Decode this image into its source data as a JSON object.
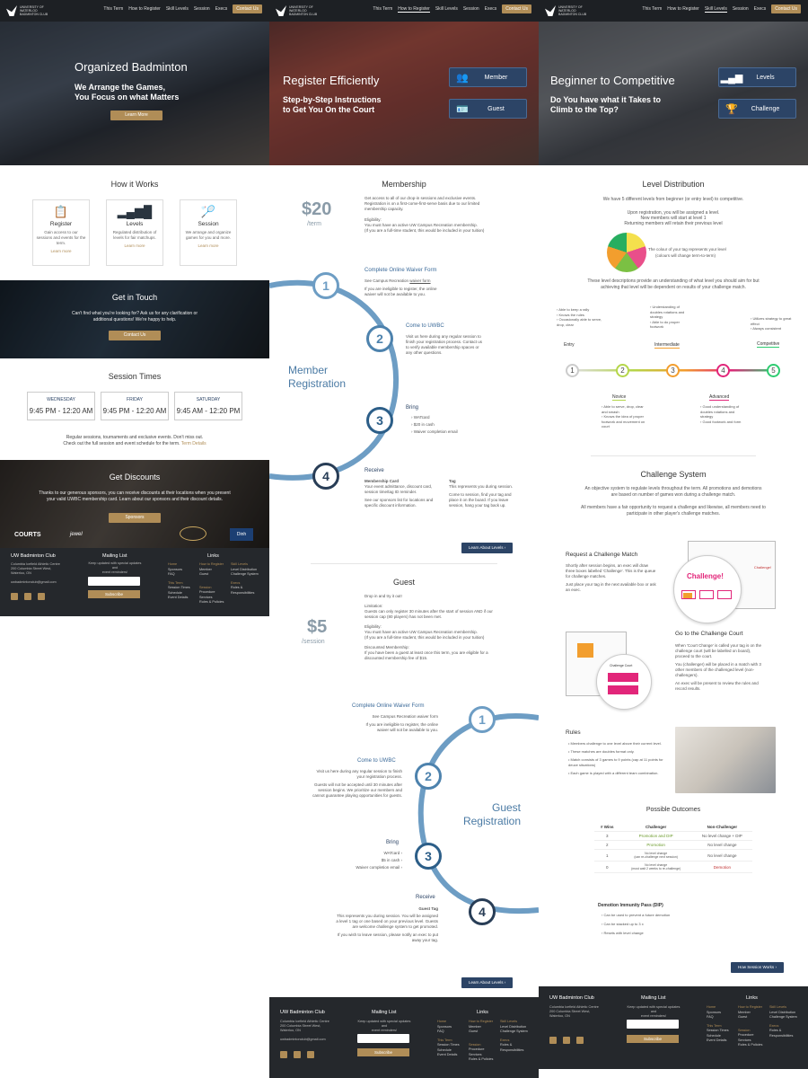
{
  "nav": {
    "logo": "UNIVERSITY OF WATERLOO BADMINTON CLUB",
    "items": [
      "This Term",
      "How to Register",
      "Skill Levels",
      "Session",
      "Execs"
    ],
    "contact": "Contact Us"
  },
  "home": {
    "hero_title": "Organized Badminton",
    "hero_sub1": "We Arrange the Games,",
    "hero_sub2": "You Focus on what Matters",
    "hero_btn": "Learn More",
    "how_title": "How it Works",
    "cards": [
      {
        "icon": "clipboard-icon",
        "title": "Register",
        "desc": "Gain access to our sessions and events for the term.",
        "link": "Learn more"
      },
      {
        "icon": "bars-icon",
        "title": "Levels",
        "desc": "Regulated distribution of levels for fair matchups.",
        "link": "Learn more"
      },
      {
        "icon": "racket-icon",
        "title": "Session",
        "desc": "We arrange and organize games for you and more.",
        "link": "Learn more"
      }
    ],
    "touch_title": "Get in Touch",
    "touch_text1": "Can't find what you're looking for? Ask us for any clarification or",
    "touch_text2": "additional questions! We're happy to help.",
    "touch_btn": "Contact Us",
    "sessions_title": "Session Times",
    "sessions": [
      {
        "day": "WEDNESDAY",
        "time": "9:45 PM - 12:20 AM"
      },
      {
        "day": "FRIDAY",
        "time": "9:45 PM - 12:20 AM"
      },
      {
        "day": "SATURDAY",
        "time": "9:45 AM - 12:20 PM"
      }
    ],
    "sessions_note1": "Regular sessions, tournaments and exclusive events. Don't miss out.",
    "sessions_note2": "Check out the full session and event schedule for the term.",
    "sessions_link": "Term Details",
    "disc_title": "Get Discounts",
    "disc_text1": "Thanks to our generous sponsors, you can receive discounts at their locations when you present",
    "disc_text2": "your valid UWBC membership card. Learn about our sponsors and their discount details.",
    "disc_btn": "Sponsors",
    "sponsors": [
      "COURTS",
      "jewel",
      "",
      "Dinh"
    ]
  },
  "footer": {
    "club": "UW Badminton Club",
    "addr1": "Columbia Icefield Athletic Centre",
    "addr2": "200 Columbia Street West,",
    "addr3": "Waterloo, ON",
    "email": "uwbadmintonclub@gmail.com",
    "mail_title": "Mailing List",
    "mail_text1": "Keep updated with special updates and",
    "mail_text2": "event reminders!",
    "mail_placeholder": "",
    "subscribe": "Subscribe",
    "links_title": "Links",
    "home": "Home",
    "home_items": [
      "Sponsors",
      "FAQ"
    ],
    "reg": "How to Register",
    "reg_items": [
      "Member",
      "Guest"
    ],
    "skill": "Skill Levels",
    "skill_items": [
      "Level Distribution",
      "Challenge System"
    ],
    "term": "This Term",
    "term_items": [
      "Session Times",
      "Schedule",
      "Event Details"
    ],
    "session": "Session",
    "session_items": [
      "Procedure",
      "Services",
      "Rules & Policies"
    ],
    "execs": "Execs",
    "execs_items": [
      "Roles & Responsibilities"
    ]
  },
  "register": {
    "hero_title": "Register Efficiently",
    "hero_sub1": "Step-by-Step Instructions",
    "hero_sub2": "to Get You On the Court",
    "btn_member": "Member",
    "btn_guest": "Guest",
    "m_title": "Membership",
    "m_price": "$20",
    "m_per": "/term",
    "m_desc1": "Get access to all of our drop-in sessions and exclusive events.",
    "m_desc2": "Registration is on a first-come-first-serve basis due to our limited",
    "m_desc3": "membership capacity.",
    "m_elig_h": "Eligibility:",
    "m_elig1": "You must have an active UW Campus Recreation membership.",
    "m_elig2": "(If you are a full-time student, this would be included in your tuition)",
    "m_reg1": "Member",
    "m_reg2": "Registration",
    "s1_title": "Complete Online Waiver Form",
    "s1_t1": "See Campus Recreation",
    "s1_link": "waiver form",
    "s1_t2": "If you are ineligible to register, the online",
    "s1_t3": "waiver will not be available to you.",
    "s2_title": "Come to UWBC",
    "s2_t1": "Visit us here during any regular session to",
    "s2_t2": "finish your registration process. Contact us",
    "s2_t3": "to verify available membership spaces or",
    "s2_t4": "any other questions.",
    "s3_title": "Bring",
    "s3_items": [
      "WATcard",
      "$20 in cash",
      "Waiver completion email"
    ],
    "s4_title": "Receive",
    "mc_h": "Membership Card",
    "mc1": "Your event admittance, discount card,",
    "mc2": "session time/tag ID reminder.",
    "mc3": "See our sponsors list for locations and",
    "mc4": "specific discount information.",
    "tag_h": "Tag",
    "tag1": "This represents you during session.",
    "tag2": "Come to session, find your tag and",
    "tag3": "place it on the board. If you leave",
    "tag4": "session, hang your tag back up.",
    "learn_levels": "Learn About Levels",
    "g_title": "Guest",
    "g_price": "$5",
    "g_per": "/session",
    "g_desc": "Drop in and try it out!",
    "g_lim_h": "Limitation:",
    "g_lim1": "Guests can only register 30 minutes after the start of session AND if our",
    "g_lim2": "session cap (80 players) has not been met.",
    "g_elig_h": "Eligibility:",
    "g_elig1": "You must have an active UW Campus Recreation membership.",
    "g_elig2": "(If you are a full-time student, this would be included in your tuition)",
    "g_disc_h": "Discounted Membership:",
    "g_disc1": "If you have been a guest at least once this term, you are eligible for a",
    "g_disc2": "discounted membership fee of $15.",
    "g_reg1": "Guest",
    "g_reg2": "Registration",
    "gs1_title": "Complete Online Waiver Form",
    "gs1_t1": "See Campus Recreation waiver form",
    "gs1_t2": "If you are ineligible to register, the online",
    "gs1_t3": "waiver will not be available to you.",
    "gs2_title": "Come to UWBC",
    "gs2_t1": "Visit us here during any regular session to finish",
    "gs2_t2": "your registration process.",
    "gs2_t3": "Guests will not be accepted until 30 minutes after",
    "gs2_t4": "session begins. We prioritize our members and",
    "gs2_t5": "cannot guarantee playing opportunities for guests.",
    "gs3_title": "Bring",
    "gs3_items": [
      "WATcard",
      "$5 in cash",
      "Waiver completion email"
    ],
    "gs4_title": "Receive",
    "gs4_h": "Guest Tag",
    "gs4_t1": "This represents you during session. You will be assigned",
    "gs4_t2": "a level 1 tag or one based on your previous level. Guests",
    "gs4_t3": "are welcome challenge system to get promoted.",
    "gs4_t4": "If you wish to leave session, please notify an exec to put",
    "gs4_t5": "away your tag."
  },
  "levels": {
    "hero_title": "Beginner to Competitive",
    "hero_sub1": "Do You have what it Takes to",
    "hero_sub2": "Climb to the Top?",
    "btn_levels": "Levels",
    "btn_challenge": "Challenge",
    "dist_title": "Level Distribution",
    "dist_intro": "We have 5 different levels from beginner (or entry level) to competitive.",
    "dist_p1": "Upon registration, you will be assigned a level.",
    "dist_p2": "New members will start at level 1",
    "dist_p3": "Returning members will retain their previous level",
    "tag_note1": "The colour of your tag represents your level",
    "tag_note2": "(colours will change term-to-term)",
    "dist_p4": "These level descriptions provide an understanding of what level you should aim for but",
    "dist_p5": "achieving that level will be dependent on results of your challenge match.",
    "lv_names": [
      "Entry",
      "Novice",
      "Intermediate",
      "Advanced",
      "Competitve"
    ],
    "entry_items": [
      "Able to keep a rally",
      "Knows the rules",
      "Occasionally able to serve, drop, clear"
    ],
    "novice_items": [
      "Able to serve, drop, clear and smash",
      "Knows the idea of proper footwork and movement on court"
    ],
    "inter_items": [
      "Understanding of doubles rotations and strategy",
      "Able to do proper footwork"
    ],
    "adv_items": [
      "Good understanding of doubles rotations and strategy",
      "Good footwork and form"
    ],
    "comp_items": [
      "Utilizes strategy to great effect",
      "Always consistent"
    ],
    "ch_title": "Challenge System",
    "ch_p1": "An objective system to regulate levels throughout the term. All promotions and demotions",
    "ch_p2": "are based on number of games won during a challenge match.",
    "ch_p3": "All members have a fair opportunity to request a challenge and likewise, all members need to",
    "ch_p4": "participate in other player's challenge matches.",
    "req_title": "Request a Challenge Match",
    "req1": "Shortly after session begins, an exec will draw",
    "req2": "three boxes labelled 'Challenge'. This is the queue",
    "req3": "for challenge matches.",
    "req4": "Just place your tag in the next available box or ask",
    "req5": "an exec.",
    "board_label": "Challenge!",
    "board_small": "Challenge!",
    "go_title": "Go to the Challenge Court",
    "go1": "When 'Court Change' is called your tag is on the",
    "go2": "challenge court (will be labelled on board),",
    "go3": "proceed to the court.",
    "go4": "You (challenger) will be placed in a match with 3",
    "go5": "other members of the challenged level (non-",
    "go6": "challengers).",
    "go7": "An exec will be present to review the rules and",
    "go8": "record results.",
    "court_label": "Challenge Court",
    "rules_title": "Rules",
    "rules": [
      "Members challenge to one level above their current level.",
      "These matches are doubles format only.",
      "Match consists of 3 games to 9 points (cap at 11 points for deuce situations)",
      "Each game is played with a different team combination."
    ],
    "out_title": "Possible Outcomes",
    "th": [
      "# Wins",
      "Challenger",
      "Non-Challenger"
    ],
    "rows": [
      [
        "3",
        "Promotion and DIP",
        "No level change + DIP"
      ],
      [
        "2",
        "Promotion",
        "No level change"
      ],
      [
        "1",
        "No level change\n(can re-challenge next session)",
        "No level change"
      ],
      [
        "0",
        "No level change\n(must wait 2 weeks to re-challenge)",
        "Demotion"
      ]
    ],
    "dip_h": "Demotion Immunity Pass (DIP)",
    "dip_items": [
      "Can be used to prevent a future demotion",
      "Can be stacked up to 3 x",
      "Resets with level change"
    ],
    "how_btn": "How Session Works"
  }
}
